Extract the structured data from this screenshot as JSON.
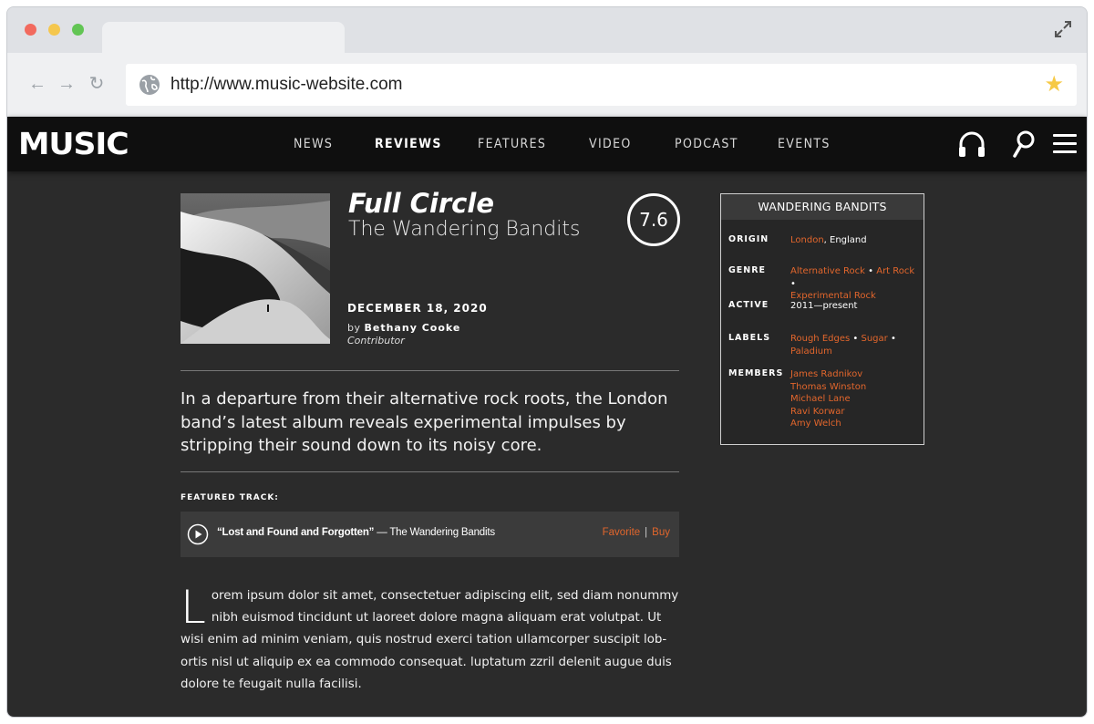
{
  "browser": {
    "url": "http://www.music-website.com",
    "buttons": {
      "back": "←",
      "forward": "→",
      "reload": "↻"
    }
  },
  "site": {
    "logo": "MUSIC",
    "nav": [
      "NEWS",
      "REVIEWS",
      "FEATURES",
      "VIDEO",
      "PODCAST",
      "EVENTS"
    ],
    "active_nav": "REVIEWS",
    "icons": [
      "headphones-icon",
      "search-icon",
      "menu-icon"
    ]
  },
  "review": {
    "album_title": "Full Circle",
    "artist": "The Wandering Bandits",
    "score": "7.6",
    "date": "DECEMBER 18, 2020",
    "by": "by",
    "author": "Bethany Cooke",
    "author_role": "Contributor",
    "dek": "In a departure from their alternative rock roots, the London band’s latest album reveals experimental impulses by stripping their sound down to its noisy core.",
    "featured_label": "FEATURED TRACK:",
    "track": {
      "title": "“Lost and Found and Forgotten”",
      "separator": "—",
      "artist": "The Wandering Bandits",
      "favorite": "Favorite",
      "divider": "|",
      "buy": "Buy"
    },
    "body_dropcap": "L",
    "body": "orem ipsum dolor sit amet, consectetuer adipiscing elit, sed diam nonummy nibh euismod tincidunt ut laoreet dolore magna aliquam erat volutpat. Ut wisi enim ad minim veniam, quis nostrud exerci tation ullamcorper suscipit lob-ortis nisl ut aliquip ex ea commodo consequat. luptatum zzril delenit augue duis dolore te feugait nulla facilisi."
  },
  "infobox": {
    "title": "WANDERING BANDITS",
    "origin_label": "ORIGIN",
    "origin_city": "London",
    "origin_rest": ", England",
    "genre_label": "GENRE",
    "genres": [
      "Alternative Rock",
      "Art Rock",
      "Experimental Rock"
    ],
    "active_label": "ACTIVE",
    "active": "2011—present",
    "labels_label": "LABELS",
    "labels": [
      "Rough Edges",
      "Sugar",
      "Paladium"
    ],
    "members_label": "MEMBERS",
    "members": [
      "James Radnikov",
      "Thomas Winston",
      "Michael Lane",
      "Ravi Korwar",
      "Amy Welch"
    ],
    "bullet": "•"
  },
  "colors": {
    "accent": "#e2662c",
    "page_bg": "#2b2b2b",
    "header_bg": "#0f0f0f",
    "star": "#f6c945"
  }
}
